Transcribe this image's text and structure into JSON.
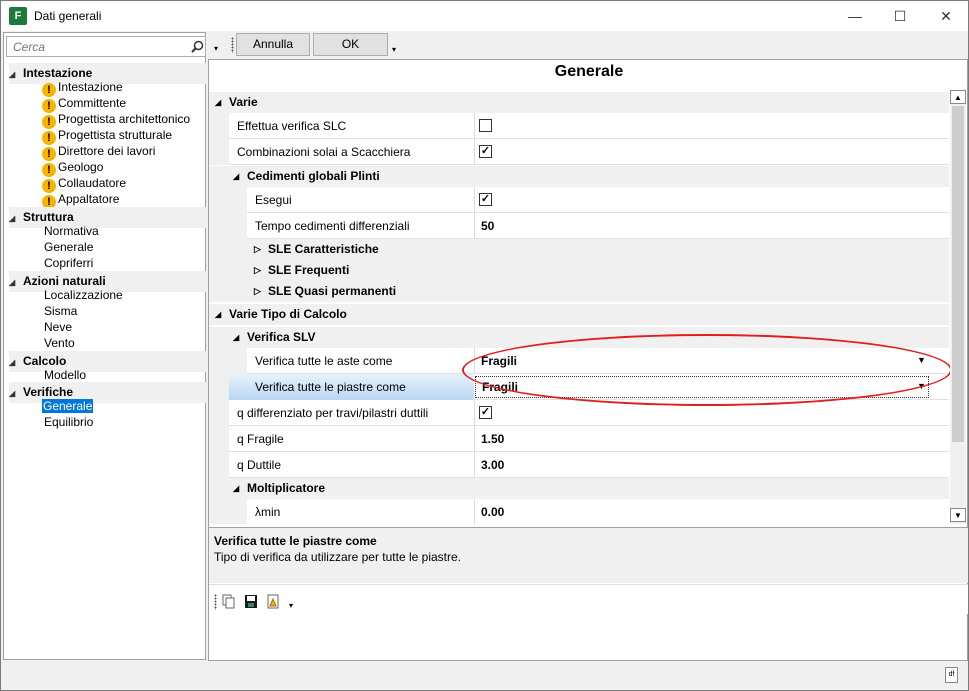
{
  "window": {
    "title": "Dati generali",
    "minimize": "—",
    "maximize": "☐",
    "close": "✕"
  },
  "search": {
    "placeholder": "Cerca"
  },
  "toolbar": {
    "cancel": "Annulla",
    "ok": "OK"
  },
  "tree": {
    "intestazione": "Intestazione",
    "intestazione_items": [
      "Intestazione",
      "Committente",
      "Progettista architettonico",
      "Progettista strutturale",
      "Direttore dei lavori",
      "Geologo",
      "Collaudatore",
      "Appaltatore"
    ],
    "struttura": "Struttura",
    "struttura_items": [
      "Normativa",
      "Generale",
      "Copriferri"
    ],
    "azioni": "Azioni naturali",
    "azioni_items": [
      "Localizzazione",
      "Sisma",
      "Neve",
      "Vento"
    ],
    "calcolo": "Calcolo",
    "calcolo_items": [
      "Modello"
    ],
    "verifiche": "Verifiche",
    "verifiche_items": [
      "Generale",
      "Equilibrio"
    ]
  },
  "main": {
    "title": "Generale"
  },
  "grid": {
    "varie": "Varie",
    "slc": "Effettua verifica SLC",
    "scacchiera": "Combinazioni solai a Scacchiera",
    "cedimenti": "Cedimenti globali Plinti",
    "esegui": "Esegui",
    "tempo": "Tempo cedimenti differenziali",
    "tempo_val": "50",
    "sle_car": "SLE Caratteristiche",
    "sle_freq": "SLE Frequenti",
    "sle_qp": "SLE Quasi permanenti",
    "tipo_calcolo": "Varie Tipo di Calcolo",
    "verifica_slv": "Verifica SLV",
    "aste": "Verifica tutte le aste come",
    "aste_val": "Fragili",
    "piastre": "Verifica tutte le piastre come",
    "piastre_val": "Fragili",
    "q_diff": "q differenziato per travi/pilastri duttili",
    "q_fragile": "q Fragile",
    "q_fragile_val": "1.50",
    "q_duttile": "q Duttile",
    "q_duttile_val": "3.00",
    "moltiplicatore": "Moltiplicatore",
    "lmin": "λmin",
    "lmin_val": "0.00"
  },
  "help": {
    "title": "Verifica tutte le piastre come",
    "desc": "Tipo di verifica da utilizzare per tutte le piastre."
  },
  "status": {
    "icon_text": "df"
  }
}
